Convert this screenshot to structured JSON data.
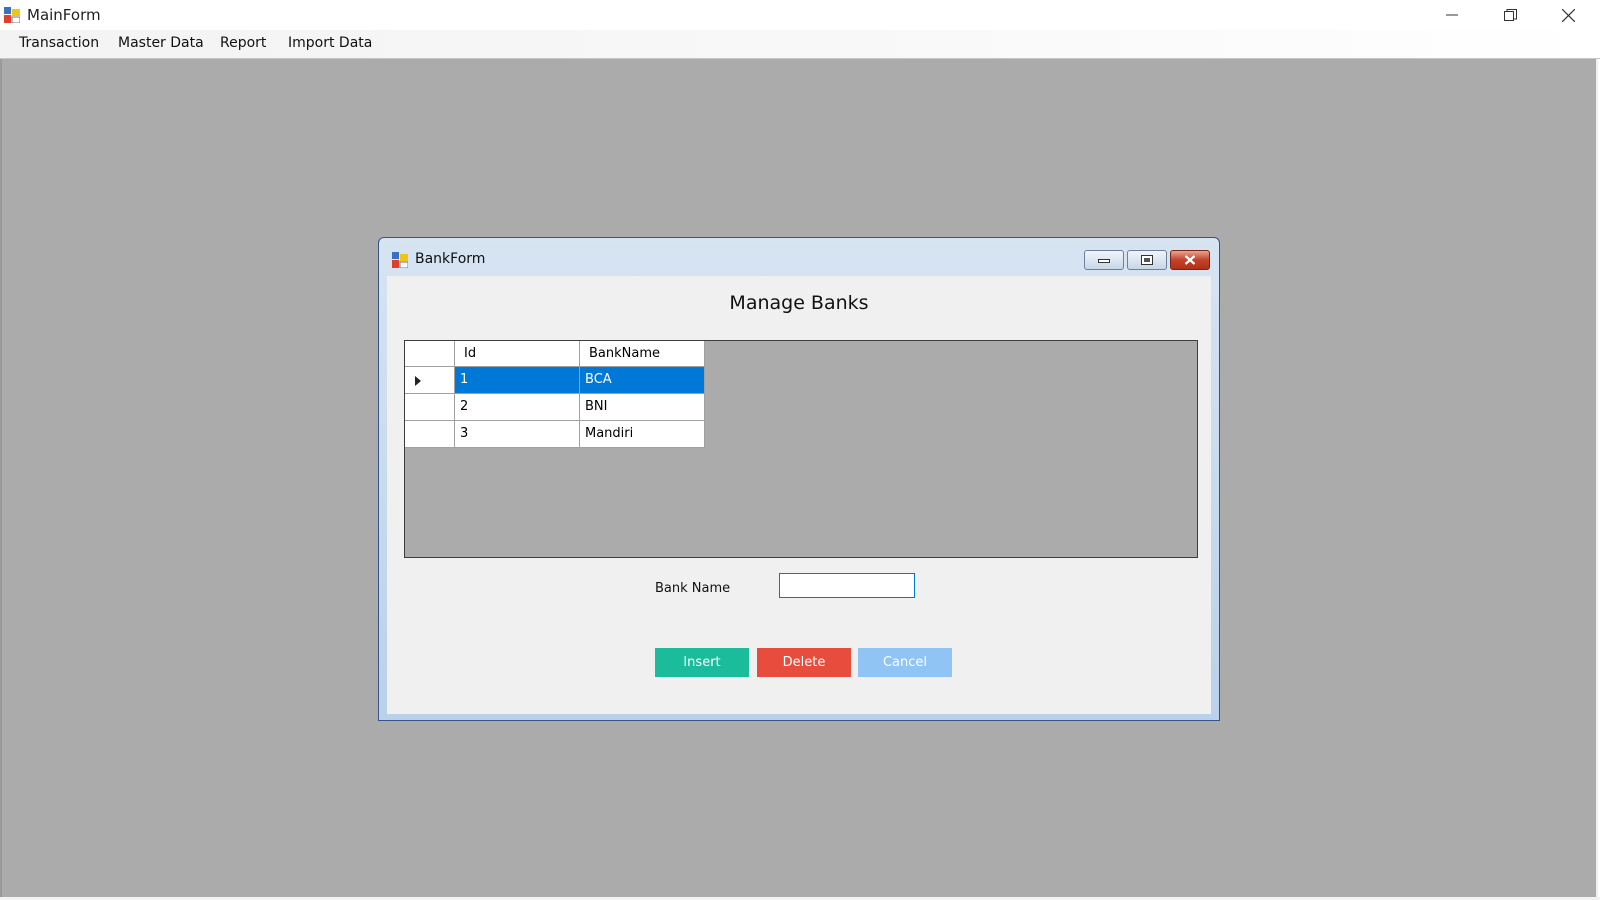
{
  "main_window": {
    "title": "MainForm",
    "controls": {
      "minimize": "minimize-icon",
      "restore": "restore-icon",
      "close": "close-icon"
    }
  },
  "menu": {
    "items": [
      "Transaction",
      "Master Data",
      "Report",
      "Import Data"
    ]
  },
  "child_window": {
    "title": "BankForm",
    "heading": "Manage Banks",
    "grid": {
      "columns": [
        "Id",
        "BankName"
      ],
      "rows": [
        {
          "id": "1",
          "name": "BCA",
          "selected": true
        },
        {
          "id": "2",
          "name": "BNI",
          "selected": false
        },
        {
          "id": "3",
          "name": "Mandiri",
          "selected": false
        }
      ]
    },
    "form": {
      "bank_name_label": "Bank Name",
      "bank_name_value": "",
      "bank_name_placeholder": ""
    },
    "buttons": {
      "insert": "Insert",
      "delete": "Delete",
      "cancel": "Cancel"
    }
  },
  "colors": {
    "insert": "#1abc9c",
    "delete": "#e74c3c",
    "cancel": "#8fc4f5",
    "selection": "#0078d7",
    "mdi_background": "#ababab"
  }
}
